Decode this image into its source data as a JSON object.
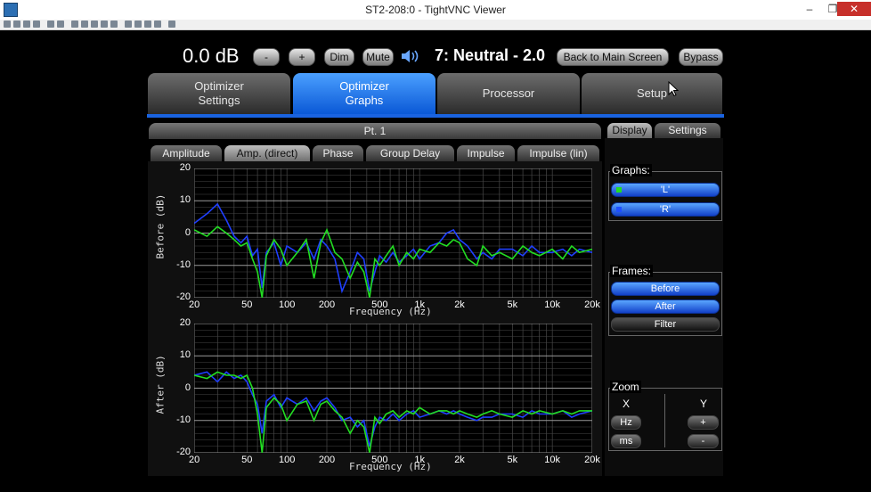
{
  "window": {
    "title": "ST2-208:0 - TightVNC Viewer",
    "minimize": "–",
    "restore": "❐",
    "close": "✕"
  },
  "toolbar_icons": [
    "new-connection-icon",
    "save-icon",
    "options-icon",
    "info-icon",
    "pause-icon",
    "refresh-icon",
    "ctrl-alt-del-icon",
    "ctrl-icon",
    "ctrl-label-icon",
    "alt-label-icon",
    "transfer-icon",
    "zoom-in-icon",
    "zoom-out-icon",
    "zoom-100-icon",
    "zoom-fit-icon",
    "fullscreen-icon"
  ],
  "toolbar_text": {
    "ctrl": "Ctrl",
    "alt": "Alt"
  },
  "header": {
    "volume": "0.0 dB",
    "minus_label": "-",
    "plus_label": "+",
    "dim_label": "Dim",
    "mute_label": "Mute",
    "preset": "7: Neutral - 2.0",
    "back_label": "Back to Main Screen",
    "bypass_label": "Bypass"
  },
  "main_tabs": [
    {
      "line1": "Optimizer",
      "line2": "Settings",
      "active": false
    },
    {
      "line1": "Optimizer",
      "line2": "Graphs",
      "active": true
    },
    {
      "line1": "Processor",
      "line2": "",
      "active": false
    },
    {
      "line1": "Setup",
      "line2": "",
      "active": false
    }
  ],
  "point_tab": "Pt. 1",
  "graph_tabs": [
    {
      "label": "Amplitude",
      "active": false
    },
    {
      "label": "Amp. (direct)",
      "active": true
    },
    {
      "label": "Phase",
      "active": false
    },
    {
      "label": "Group Delay",
      "active": false
    },
    {
      "label": "Impulse",
      "active": false
    },
    {
      "label": "Impulse (lin)",
      "active": false
    }
  ],
  "side_tabs": [
    {
      "label": "Display",
      "active": true
    },
    {
      "label": "Settings",
      "active": false
    }
  ],
  "graphs_group": {
    "title": "Graphs:",
    "items": [
      {
        "label": "'L'",
        "color": "#22dd22"
      },
      {
        "label": "'R'",
        "color": "#1f4fff"
      }
    ]
  },
  "frames_group": {
    "title": "Frames:",
    "items": [
      {
        "label": "Before",
        "active": true
      },
      {
        "label": "After",
        "active": true
      },
      {
        "label": "Filter",
        "active": false
      }
    ]
  },
  "zoom_group": {
    "title": "Zoom",
    "x_label": "X",
    "y_label": "Y",
    "hz_label": "Hz",
    "ms_label": "ms",
    "y_plus": "+",
    "y_minus": "-"
  },
  "chart_data": [
    {
      "type": "line",
      "xlabel": "Frequency (Hz)",
      "ylabel": "Before (dB)",
      "xscale": "log",
      "xlim": [
        20,
        20000
      ],
      "ylim": [
        -20,
        20
      ],
      "xticks": [
        20,
        50,
        100,
        200,
        500,
        1000,
        2000,
        5000,
        10000,
        20000
      ],
      "xtick_labels": [
        "20",
        "50",
        "100",
        "200",
        "500",
        "1k",
        "2k",
        "5k",
        "10k",
        "20k"
      ],
      "yticks": [
        20,
        10,
        0,
        -10,
        -20
      ],
      "grid": true,
      "series": [
        {
          "color": "#1f3fff",
          "x": [
            20,
            25,
            30,
            35,
            40,
            45,
            50,
            55,
            60,
            65,
            70,
            80,
            90,
            100,
            120,
            140,
            160,
            180,
            200,
            230,
            260,
            300,
            340,
            380,
            420,
            460,
            500,
            560,
            630,
            700,
            800,
            900,
            1000,
            1200,
            1400,
            1600,
            1800,
            2000,
            2300,
            2700,
            3000,
            3500,
            4000,
            5000,
            6000,
            7000,
            8000,
            10000,
            12000,
            14000,
            16000,
            20000
          ],
          "y": [
            3,
            6,
            9,
            4,
            -1,
            -3,
            -1,
            -7,
            -5,
            -17,
            -6,
            -3,
            -10,
            -4,
            -6,
            -3,
            -8,
            -2,
            -4,
            -8,
            -18,
            -12,
            -6,
            -8,
            -18,
            -12,
            -7,
            -9,
            -6,
            -9,
            -7,
            -5,
            -8,
            -4,
            -3,
            0,
            1,
            -2,
            -4,
            -8,
            -6,
            -8,
            -5,
            -5,
            -7,
            -4,
            -6,
            -6,
            -5,
            -7,
            -5,
            -6
          ]
        },
        {
          "color": "#22dd22",
          "x": [
            20,
            25,
            30,
            35,
            40,
            45,
            50,
            55,
            60,
            65,
            70,
            80,
            90,
            100,
            120,
            140,
            160,
            180,
            200,
            230,
            260,
            300,
            340,
            380,
            420,
            460,
            500,
            560,
            630,
            700,
            800,
            900,
            1000,
            1200,
            1400,
            1600,
            1800,
            2000,
            2300,
            2700,
            3000,
            3500,
            4000,
            5000,
            6000,
            7000,
            8000,
            10000,
            12000,
            14000,
            16000,
            20000
          ],
          "y": [
            1,
            -1,
            2,
            0,
            -2,
            -4,
            -3,
            -8,
            -12,
            -20,
            -7,
            -2,
            -5,
            -10,
            -6,
            -2,
            -14,
            -3,
            1,
            -6,
            -8,
            -14,
            -9,
            -12,
            -20,
            -8,
            -10,
            -7,
            -4,
            -10,
            -6,
            -8,
            -5,
            -6,
            -3,
            -4,
            -2,
            -3,
            -8,
            -10,
            -4,
            -7,
            -6,
            -8,
            -4,
            -6,
            -7,
            -5,
            -8,
            -4,
            -6,
            -5
          ]
        }
      ]
    },
    {
      "type": "line",
      "xlabel": "Frequency (Hz)",
      "ylabel": "After (dB)",
      "xscale": "log",
      "xlim": [
        20,
        20000
      ],
      "ylim": [
        -20,
        20
      ],
      "xticks": [
        20,
        50,
        100,
        200,
        500,
        1000,
        2000,
        5000,
        10000,
        20000
      ],
      "xtick_labels": [
        "20",
        "50",
        "100",
        "200",
        "500",
        "1k",
        "2k",
        "5k",
        "10k",
        "20k"
      ],
      "yticks": [
        20,
        10,
        0,
        -10,
        -20
      ],
      "grid": true,
      "series": [
        {
          "color": "#1f3fff",
          "x": [
            20,
            25,
            30,
            35,
            40,
            45,
            50,
            55,
            60,
            65,
            70,
            80,
            90,
            100,
            120,
            140,
            160,
            180,
            200,
            230,
            260,
            300,
            340,
            380,
            420,
            460,
            500,
            560,
            630,
            700,
            800,
            900,
            1000,
            1200,
            1400,
            1600,
            1800,
            2000,
            2300,
            2700,
            3000,
            3500,
            4000,
            5000,
            6000,
            7000,
            8000,
            10000,
            12000,
            14000,
            16000,
            20000
          ],
          "y": [
            4,
            5,
            2,
            5,
            3,
            4,
            2,
            -2,
            -5,
            -14,
            -4,
            -2,
            -6,
            -3,
            -5,
            -3,
            -7,
            -4,
            -3,
            -6,
            -10,
            -9,
            -12,
            -10,
            -18,
            -12,
            -9,
            -10,
            -8,
            -10,
            -8,
            -7,
            -9,
            -8,
            -7,
            -8,
            -7,
            -8,
            -9,
            -10,
            -9,
            -9,
            -8,
            -8,
            -9,
            -7,
            -8,
            -8,
            -7,
            -9,
            -8,
            -7
          ]
        },
        {
          "color": "#22dd22",
          "x": [
            20,
            25,
            30,
            35,
            40,
            45,
            50,
            55,
            60,
            65,
            70,
            80,
            90,
            100,
            120,
            140,
            160,
            180,
            200,
            230,
            260,
            300,
            340,
            380,
            420,
            460,
            500,
            560,
            630,
            700,
            800,
            900,
            1000,
            1200,
            1400,
            1600,
            1800,
            2000,
            2300,
            2700,
            3000,
            3500,
            4000,
            5000,
            6000,
            7000,
            8000,
            10000,
            12000,
            14000,
            16000,
            20000
          ],
          "y": [
            4,
            3,
            5,
            4,
            4,
            3,
            4,
            0,
            -8,
            -20,
            -6,
            -3,
            -5,
            -10,
            -5,
            -4,
            -10,
            -5,
            -4,
            -7,
            -9,
            -14,
            -10,
            -12,
            -20,
            -9,
            -11,
            -8,
            -7,
            -9,
            -7,
            -8,
            -6,
            -8,
            -7,
            -7,
            -8,
            -7,
            -8,
            -9,
            -8,
            -7,
            -8,
            -9,
            -7,
            -8,
            -7,
            -8,
            -7,
            -8,
            -7,
            -7
          ]
        }
      ]
    }
  ]
}
